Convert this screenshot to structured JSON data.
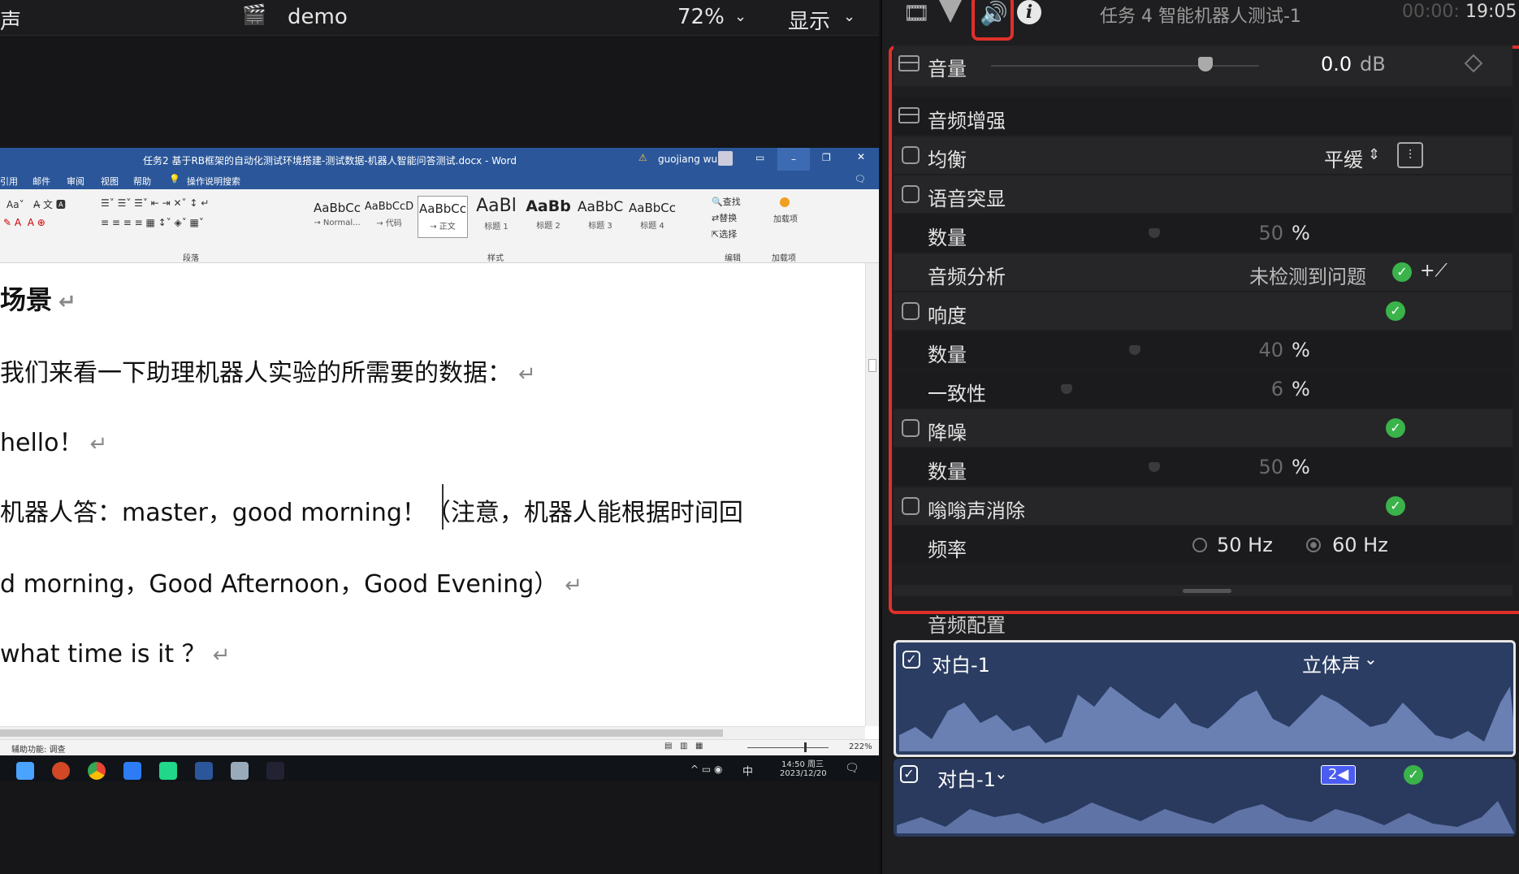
{
  "viewer": {
    "left_label": "声",
    "project_name": "demo",
    "zoom": "72%",
    "display_label": "显示"
  },
  "word": {
    "title": "任务2 基于RB框架的自动化测试环境搭建-测试数据-机器人智能问答测试.docx - Word",
    "user": "guojiang wu",
    "menu": [
      "引用",
      "邮件",
      "审阅",
      "视图",
      "帮助",
      "操作说明搜索"
    ],
    "styles": [
      {
        "sample": "AaBbCc",
        "name": "→ Normal..."
      },
      {
        "sample": "AaBbCcD",
        "name": "→ 代码"
      },
      {
        "sample": "AaBbCc",
        "name": "→ 正文"
      },
      {
        "sample": "AaBl",
        "name": "标题 1"
      },
      {
        "sample": "AaBb",
        "name": "标题 2"
      },
      {
        "sample": "AaBbC",
        "name": "标题 3"
      },
      {
        "sample": "AaBbCc",
        "name": "标题 4"
      }
    ],
    "ribbon_groups": {
      "paragraph": "段落",
      "styles": "样式",
      "edit": "编辑",
      "addins": "加载项"
    },
    "edit_items": [
      "查找",
      "替换",
      "选择"
    ],
    "addin_label": "加载项",
    "doc_lines": [
      "场景",
      "我们来看一下助理机器人实验的所需要的数据：",
      "hello！",
      "机器人答：master，good morning！（注意，机器人能根据时间回",
      "d morning，Good Afternoon，Good Evening）",
      "what time is it ？"
    ],
    "status_left": "辅助功能: 调查",
    "zoom": "222%",
    "clock_time": "14:50 周三",
    "clock_date": "2023/12/20",
    "ime": "中"
  },
  "inspector": {
    "clip_title": "任务 4 智能机器人测试-1",
    "timecode_dim": "00:00:",
    "timecode": "19:05",
    "volume_label": "音量",
    "volume_value": "0.0",
    "volume_unit": "dB",
    "enhance_title": "音频增强",
    "eq_label": "均衡",
    "eq_value": "平缓",
    "voice_label": "语音突显",
    "amount_label": "数量",
    "voice_amount": "50",
    "analysis_label": "音频分析",
    "analysis_status": "未检测到问题",
    "loudness_label": "响度",
    "loudness_amount": "40",
    "uniformity_label": "一致性",
    "uniformity_value": "6",
    "noise_label": "降噪",
    "noise_amount": "50",
    "hum_label": "嗡嗡声消除",
    "freq_label": "频率",
    "freq_a": "50 Hz",
    "freq_b": "60 Hz",
    "pct": "%",
    "config_title": "音频配置",
    "clip1_name": "对白-1",
    "clip1_mode": "立体声",
    "clip2_name": "对白-1",
    "clip2_badge": "2"
  },
  "colors": {
    "accent_blue": "#4a5cf2",
    "highlight_red": "#e0302a",
    "ok_green": "#3ab34a",
    "word_blue": "#2b579a"
  }
}
